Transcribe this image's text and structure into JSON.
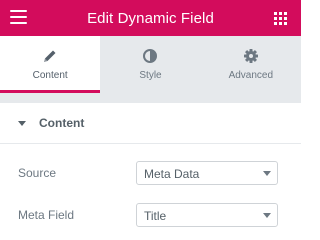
{
  "header": {
    "title": "Edit Dynamic Field",
    "accent_color": "#d30c5c",
    "menu_icon": "hamburger-icon",
    "apps_icon": "grid-icon"
  },
  "tabs": [
    {
      "label": "Content",
      "icon": "pencil-icon",
      "active": true
    },
    {
      "label": "Style",
      "icon": "contrast-circle-icon",
      "active": false
    },
    {
      "label": "Advanced",
      "icon": "gear-icon",
      "active": false
    }
  ],
  "section": {
    "title": "Content",
    "caret_icon": "caret-down-icon"
  },
  "fields": {
    "source": {
      "label": "Source",
      "value": "Meta Data"
    },
    "meta_field": {
      "label": "Meta Field",
      "value": "Title"
    }
  }
}
